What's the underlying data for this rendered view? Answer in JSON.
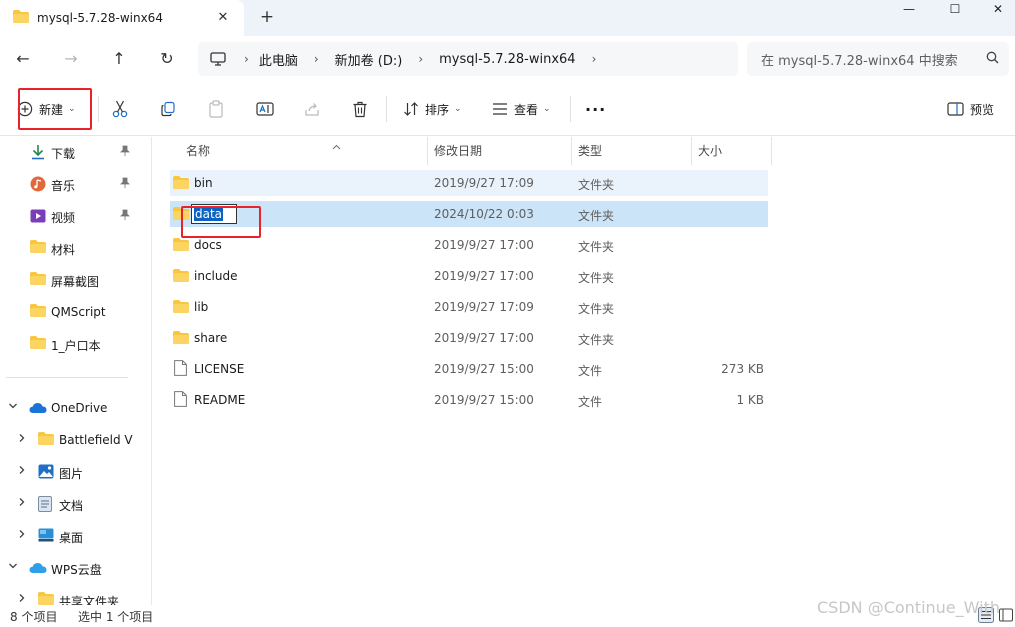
{
  "window": {
    "tab_title": "mysql-5.7.28-winx64",
    "tab_close_glyph": "✕",
    "new_tab_glyph": "+",
    "minimize_glyph": "—",
    "maximize_glyph": "☐",
    "close_glyph": "✕"
  },
  "nav": {
    "back_glyph": "←",
    "forward_glyph": "→",
    "up_glyph": "↑",
    "refresh_glyph": "↻"
  },
  "address": {
    "segments": [
      "此电脑",
      "新加卷 (D:)",
      "mysql-5.7.28-winx64"
    ],
    "separator": "›"
  },
  "search": {
    "placeholder": "在 mysql-5.7.28-winx64 中搜索"
  },
  "toolbar": {
    "new_label": "新建",
    "sort_label": "排序",
    "view_label": "查看",
    "more_glyph": "···",
    "preview_label": "预览",
    "chevron": "⌄"
  },
  "sidebar": {
    "pin_glyph": "📌",
    "quick_access": [
      {
        "label": "下载",
        "icon": "download-icon",
        "pinned": true
      },
      {
        "label": "音乐",
        "icon": "music-icon",
        "pinned": true
      },
      {
        "label": "视频",
        "icon": "video-icon",
        "pinned": true
      },
      {
        "label": "材料",
        "icon": "folder-icon",
        "pinned": false
      },
      {
        "label": "屏幕截图",
        "icon": "folder-icon",
        "pinned": false
      },
      {
        "label": "QMScript",
        "icon": "folder-icon",
        "pinned": false
      },
      {
        "label": "1_户口本",
        "icon": "folder-icon",
        "pinned": false
      }
    ],
    "onedrive": {
      "label": "OneDrive",
      "children": [
        {
          "label": "Battlefield V",
          "icon": "folder-icon"
        },
        {
          "label": "图片",
          "icon": "pictures-icon"
        },
        {
          "label": "文档",
          "icon": "documents-icon"
        },
        {
          "label": "桌面",
          "icon": "desktop-icon"
        }
      ]
    },
    "wps": {
      "label": "WPS云盘",
      "children": [
        {
          "label": "共享文件夹",
          "icon": "folder-icon"
        }
      ]
    }
  },
  "columns": {
    "name": "名称",
    "modified": "修改日期",
    "type": "类型",
    "size": "大小"
  },
  "files": [
    {
      "name": "bin",
      "modified": "2019/9/27 17:09",
      "type": "文件夹",
      "size": "",
      "kind": "folder",
      "state": "hover"
    },
    {
      "name": "data",
      "modified": "2024/10/22 0:03",
      "type": "文件夹",
      "size": "",
      "kind": "folder",
      "state": "selected"
    },
    {
      "name": "docs",
      "modified": "2019/9/27 17:00",
      "type": "文件夹",
      "size": "",
      "kind": "folder",
      "state": ""
    },
    {
      "name": "include",
      "modified": "2019/9/27 17:00",
      "type": "文件夹",
      "size": "",
      "kind": "folder",
      "state": ""
    },
    {
      "name": "lib",
      "modified": "2019/9/27 17:09",
      "type": "文件夹",
      "size": "",
      "kind": "folder",
      "state": ""
    },
    {
      "name": "share",
      "modified": "2019/9/27 17:00",
      "type": "文件夹",
      "size": "",
      "kind": "folder",
      "state": ""
    },
    {
      "name": "LICENSE",
      "modified": "2019/9/27 15:00",
      "type": "文件",
      "size": "273 KB",
      "kind": "file",
      "state": ""
    },
    {
      "name": "README",
      "modified": "2019/9/27 15:00",
      "type": "文件",
      "size": "1 KB",
      "kind": "file",
      "state": ""
    }
  ],
  "rename": {
    "value": "data"
  },
  "status": {
    "item_count": "8 个项目",
    "selected": "选中 1 个项目"
  },
  "watermark": "CSDN @Continue_With",
  "colors": {
    "accent": "#0b62c2",
    "highlight_red": "#e8232a",
    "selected_row": "#cce4f7",
    "hover_row": "#eaf3fc",
    "folder_yellow": "#f8c63f"
  }
}
